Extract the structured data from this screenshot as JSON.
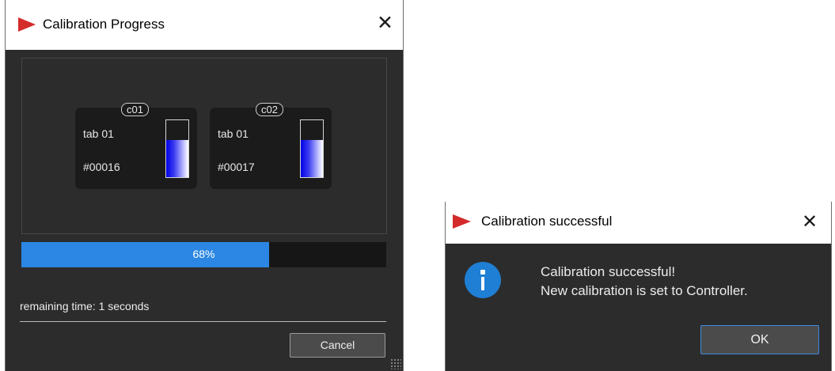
{
  "progress_dialog": {
    "title": "Calibration Progress",
    "channels": [
      {
        "badge": "c01",
        "tab": "tab 01",
        "id": "#00016",
        "level_fraction": 0.65
      },
      {
        "badge": "c02",
        "tab": "tab 01",
        "id": "#00017",
        "level_fraction": 0.65
      }
    ],
    "progress": {
      "value_percent": 68,
      "label": "68%"
    },
    "remaining_time": "remaining time: 1 seconds",
    "cancel_label": "Cancel"
  },
  "success_dialog": {
    "title": "Calibration successful",
    "message_line1": "Calibration successful!",
    "message_line2": "New calibration is set to Controller.",
    "ok_label": "OK"
  },
  "icons": {
    "close": "close-icon",
    "app": "app-logo-icon",
    "info": "info-icon"
  },
  "colors": {
    "logo_red": "#d42b2b",
    "progress_blue": "#2b87e3",
    "level_blue": "#0000e6",
    "info_blue": "#1e7fd4",
    "dark_bg": "#2c2c2c"
  }
}
